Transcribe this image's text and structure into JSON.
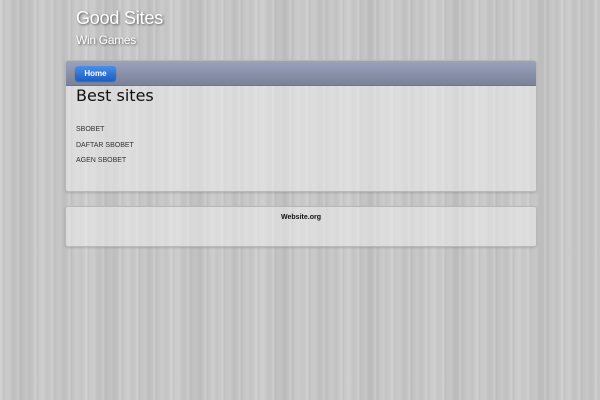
{
  "header": {
    "title": "Good Sites",
    "tagline": "Win Games"
  },
  "nav": {
    "items": [
      {
        "label": "Home"
      }
    ]
  },
  "main": {
    "heading": "Best sites",
    "links": [
      {
        "label": "SBOBET"
      },
      {
        "label": "DAFTAR SBOBET"
      },
      {
        "label": "AGEN SBOBET"
      }
    ]
  },
  "footer": {
    "text": "Website.org"
  },
  "colors": {
    "nav_bar": "#8a92ab",
    "nav_button": "#2a6fd6",
    "background": "#c9c9c9"
  }
}
